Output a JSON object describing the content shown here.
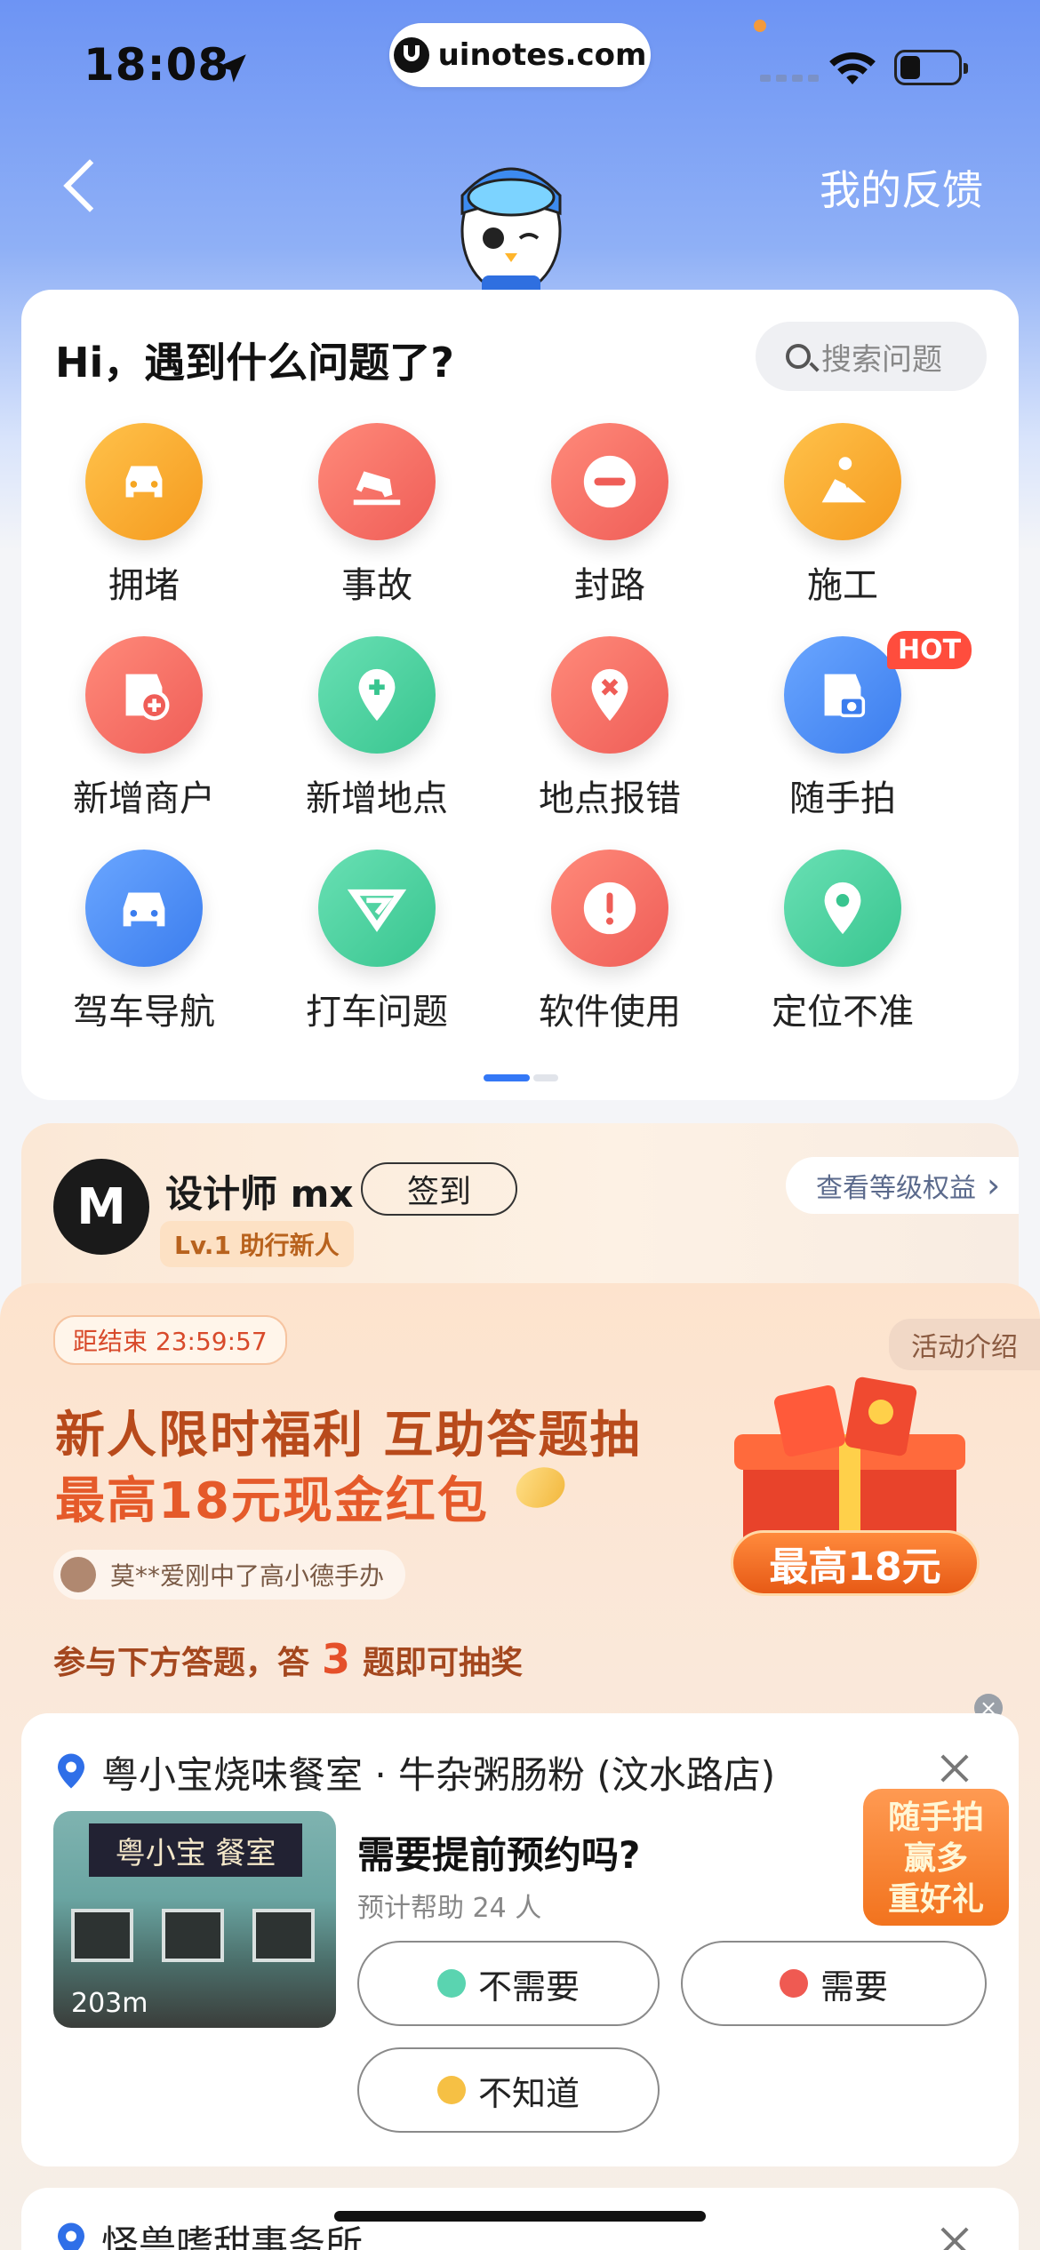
{
  "status": {
    "time": "18:08",
    "url": "uinotes.com"
  },
  "nav": {
    "feedback_label": "我的反馈"
  },
  "main": {
    "greeting": "Hi，遇到什么问题了?",
    "search_label": "搜索问题",
    "categories": [
      {
        "label": "拥堵",
        "icon": "car-front-icon",
        "color": "orange"
      },
      {
        "label": "事故",
        "icon": "car-crash-icon",
        "color": "red"
      },
      {
        "label": "封路",
        "icon": "no-entry-icon",
        "color": "red"
      },
      {
        "label": "施工",
        "icon": "construction-worker-icon",
        "color": "orange"
      },
      {
        "label": "新增商户",
        "icon": "add-shop-icon",
        "color": "red"
      },
      {
        "label": "新增地点",
        "icon": "add-location-icon",
        "color": "green"
      },
      {
        "label": "地点报错",
        "icon": "location-error-icon",
        "color": "red"
      },
      {
        "label": "随手拍",
        "icon": "shop-camera-icon",
        "color": "blue",
        "badge": "HOT"
      },
      {
        "label": "驾车导航",
        "icon": "car-icon",
        "color": "blue"
      },
      {
        "label": "打车问题",
        "icon": "taxi-logo-icon",
        "color": "green"
      },
      {
        "label": "软件使用",
        "icon": "exclamation-icon",
        "color": "red"
      },
      {
        "label": "定位不准",
        "icon": "location-pin-icon",
        "color": "green"
      }
    ]
  },
  "user": {
    "avatar_text": "M",
    "name": "设计师 mx",
    "signin_label": "签到",
    "level": "Lv.1 助行新人",
    "level_link": "查看等级权益"
  },
  "promo": {
    "countdown": "距结束 23:59:57",
    "intro_label": "活动介绍",
    "title_line1": "新人限时福利 互助答题抽",
    "title_line2": "最高18元现金红包",
    "winner_text": "莫**爱刚中了高小德手办",
    "gift_badge": "最高18元",
    "task_prefix": "参与下方答题，答",
    "task_count": "3",
    "task_suffix": "题即可抽奖"
  },
  "question": {
    "poi_name": "粤小宝烧味餐室 · 牛杂粥肠粉 (汶水路店)",
    "photo_sign": "粤小宝 餐室",
    "distance": "203m",
    "title": "需要提前预约吗?",
    "subtitle": "预计帮助 24 人",
    "options": [
      "不需要",
      "需要",
      "不知道"
    ]
  },
  "floating_badge": {
    "line1": "随手拍",
    "line2": "赢多",
    "line3": "重好礼"
  },
  "next_card": {
    "poi_name": "怪兽嗜甜事务所"
  },
  "colors": {
    "accent_blue": "#3478f6",
    "promo_orange": "#e55a2a",
    "hot_red": "#ff4d3d"
  }
}
